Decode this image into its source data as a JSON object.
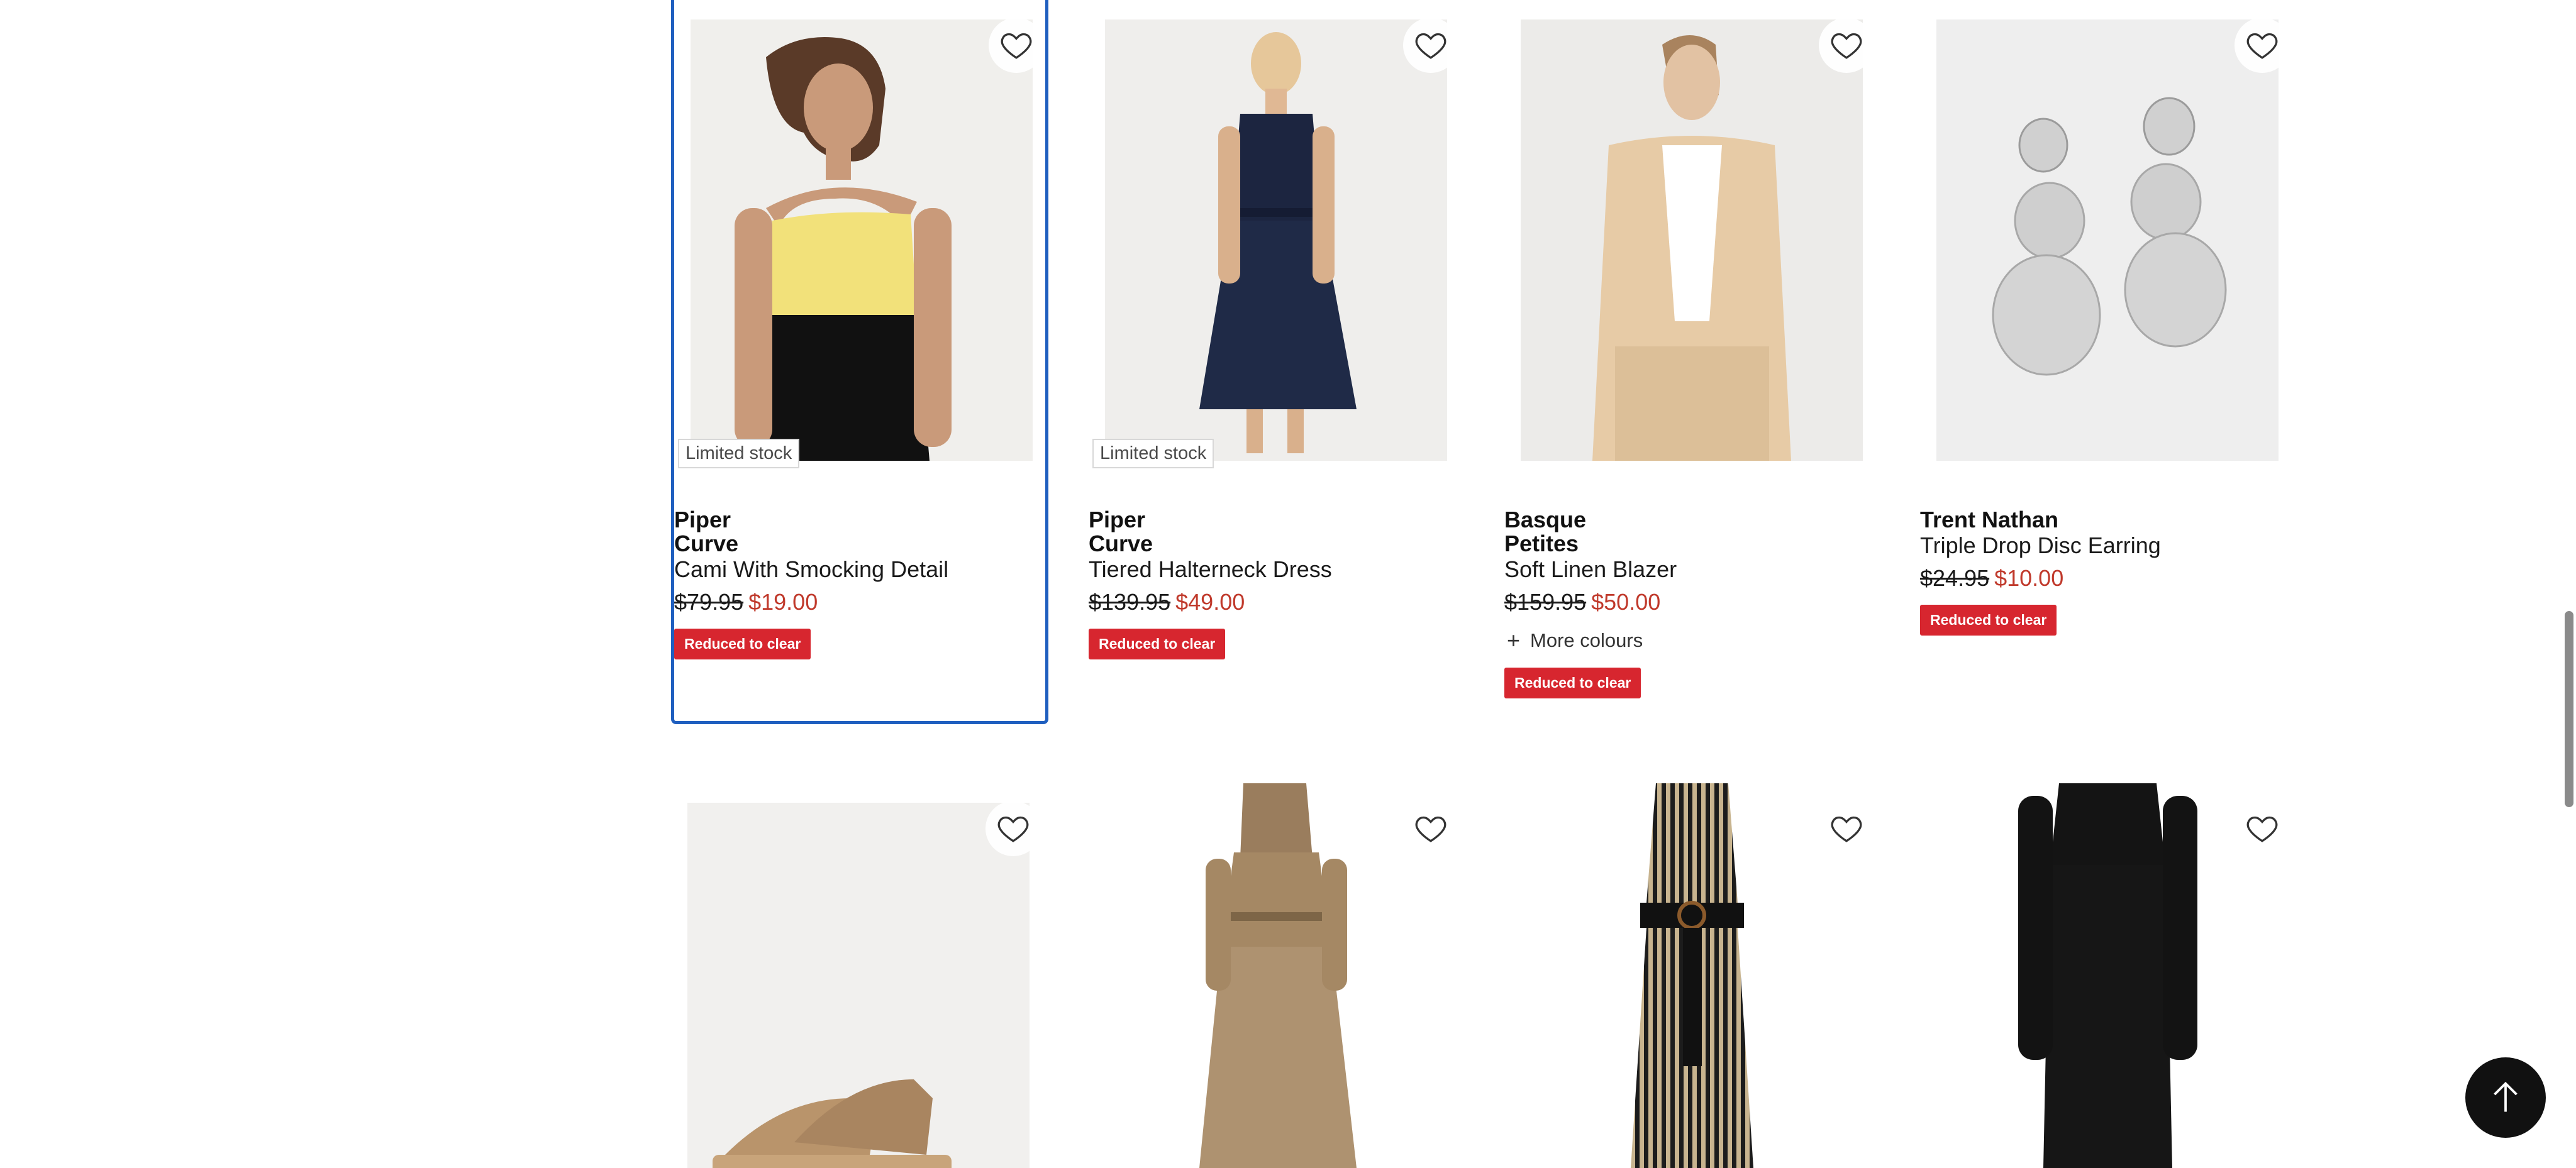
{
  "products": [
    {
      "stock_label": "Limited stock",
      "brand_line1": "Piper",
      "brand_line2": "Curve",
      "name": "Cami With Smocking Detail",
      "was_price": "$79.95",
      "now_price": "$19.00",
      "badge": "Reduced to clear"
    },
    {
      "stock_label": "Limited stock",
      "brand_line1": "Piper",
      "brand_line2": "Curve",
      "name": "Tiered Halterneck Dress",
      "was_price": "$139.95",
      "now_price": "$49.00",
      "badge": "Reduced to clear"
    },
    {
      "brand_line1": "Basque",
      "brand_line2": "Petites",
      "name": "Soft Linen Blazer",
      "was_price": "$159.95",
      "now_price": "$50.00",
      "more_colours": "More colours",
      "badge": "Reduced to clear"
    },
    {
      "brand_line1": "Trent Nathan",
      "name": "Triple Drop Disc Earring",
      "was_price": "$24.95",
      "now_price": "$10.00",
      "badge": "Reduced to clear"
    }
  ],
  "colors": {
    "sale_price": "#c0392b",
    "badge_bg": "#d7262f",
    "focus_ring": "#1f5fbf"
  },
  "icons": {
    "wishlist": "heart-outline-icon",
    "back_to_top": "arrow-up-icon",
    "more_colours": "plus-icon"
  }
}
